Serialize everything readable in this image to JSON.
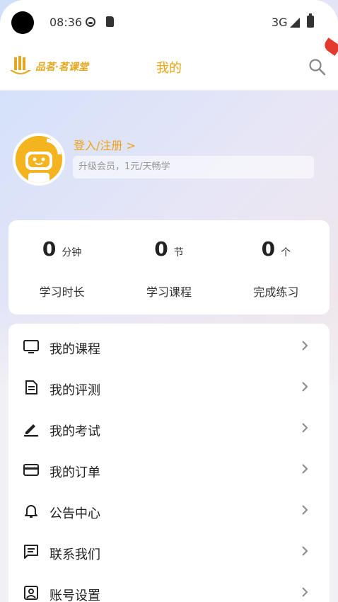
{
  "status_bar": {
    "time": "08:36",
    "network": "3G"
  },
  "header": {
    "logo_text": "品茗·茗课堂",
    "title": "我的"
  },
  "profile": {
    "login_label": "登入/注册 >",
    "member_text": "升级会员，1元/天畅学"
  },
  "stats": [
    {
      "value": "0",
      "unit": "分钟",
      "label": "学习时长"
    },
    {
      "value": "0",
      "unit": "节",
      "label": "学习课程"
    },
    {
      "value": "0",
      "unit": "个",
      "label": "完成练习"
    }
  ],
  "menu": [
    {
      "icon": "tv-icon",
      "label": "我的课程"
    },
    {
      "icon": "document-icon",
      "label": "我的评测"
    },
    {
      "icon": "pencil-icon",
      "label": "我的考试"
    },
    {
      "icon": "credit-card-icon",
      "label": "我的订单"
    },
    {
      "icon": "bell-icon",
      "label": "公告中心"
    },
    {
      "icon": "chat-icon",
      "label": "联系我们"
    },
    {
      "icon": "account-box-icon",
      "label": "账号设置"
    }
  ],
  "colors": {
    "accent": "#e8a412",
    "login_link": "#f0a21a",
    "avatar_bg": "#f4b41f"
  }
}
